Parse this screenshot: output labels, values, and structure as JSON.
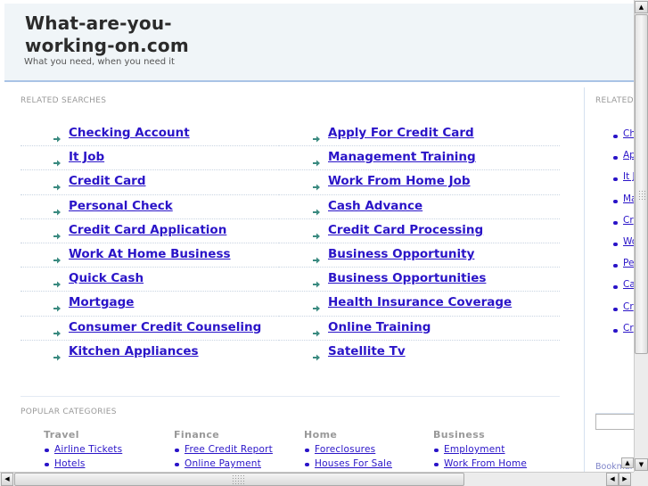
{
  "header": {
    "site_title": "What-are-you-working-on.com",
    "tagline": "What you need, when you need it"
  },
  "related_searches": {
    "label": "RELATED SEARCHES",
    "left": [
      "Checking Account",
      "It Job",
      "Credit Card",
      "Personal Check",
      "Credit Card Application",
      "Work At Home Business",
      "Quick Cash",
      "Mortgage",
      "Consumer Credit Counseling",
      "Kitchen Appliances"
    ],
    "right": [
      "Apply For Credit Card",
      "Management Training",
      "Work From Home Job",
      "Cash Advance",
      "Credit Card Processing",
      "Business Opportunity",
      "Business Opportunities",
      "Health Insurance Coverage",
      "Online Training",
      "Satellite Tv"
    ]
  },
  "popular_categories": {
    "label": "POPULAR CATEGORIES",
    "columns": [
      {
        "heading": "Travel",
        "links": [
          "Airline Tickets",
          "Hotels"
        ]
      },
      {
        "heading": "Finance",
        "links": [
          "Free Credit Report",
          "Online Payment"
        ]
      },
      {
        "heading": "Home",
        "links": [
          "Foreclosures",
          "Houses For Sale"
        ]
      },
      {
        "heading": "Business",
        "links": [
          "Employment",
          "Work From Home"
        ]
      }
    ]
  },
  "sidebar": {
    "label": "RELATED",
    "links": [
      "Ch",
      "Ap",
      "It J",
      "Ma",
      "Cr",
      "Wo",
      "Pe",
      "Ca",
      "Cr",
      "Cr"
    ],
    "search_input_value": "",
    "bookmark_label": "Bookmark"
  },
  "icons": {
    "related_search_bullet": "teal-arrow-icon",
    "category_bullet": "blue-dot-icon",
    "scroll_up": "▲",
    "scroll_down": "▼",
    "scroll_left": "◀",
    "scroll_right": "▶"
  },
  "colors": {
    "link": "#2a14c8",
    "header_bg": "#f0f5f8",
    "header_border": "#a9c3e6",
    "arrow": "#3a8a80"
  }
}
